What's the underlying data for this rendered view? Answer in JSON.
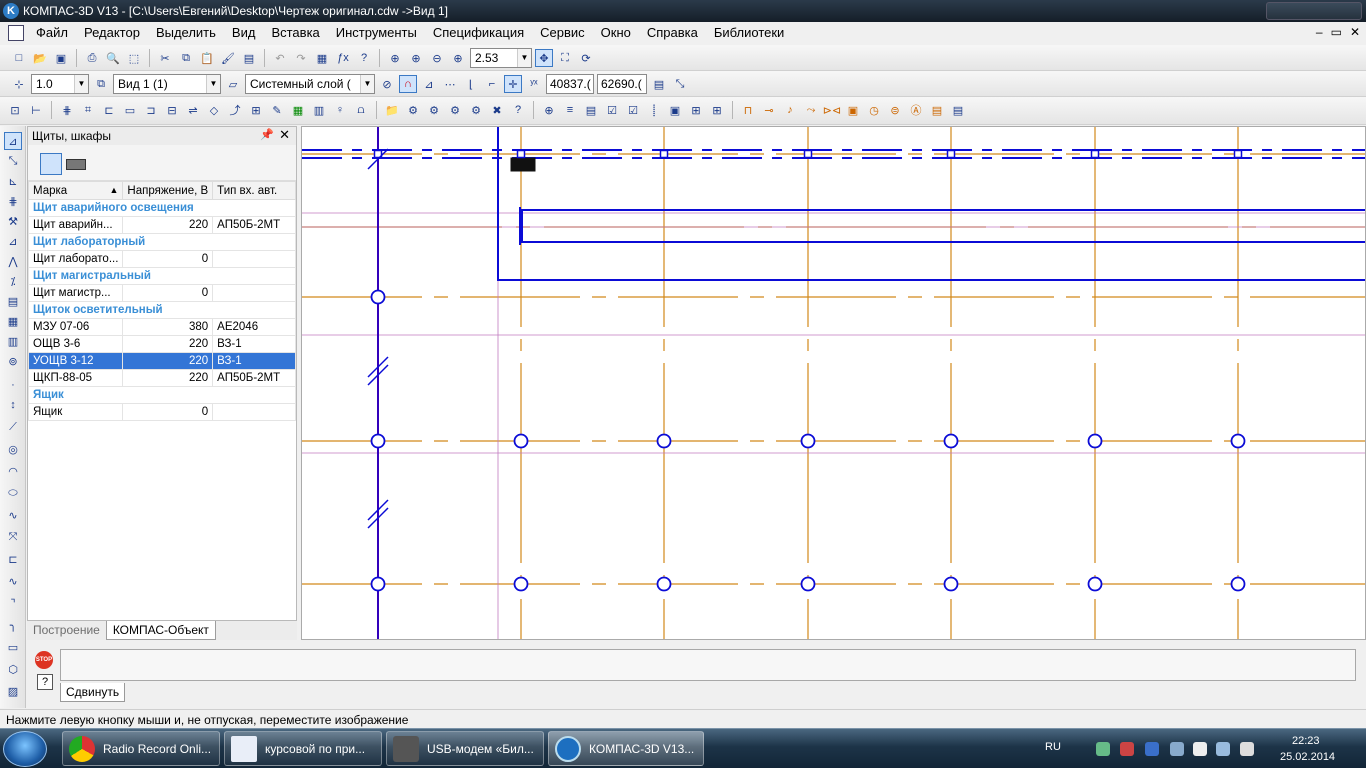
{
  "window": {
    "title": "КОМПАС-3D V13 - [C:\\Users\\Евгений\\Desktop\\Чертеж оригинал.cdw ->Вид 1]"
  },
  "menu": [
    "Файл",
    "Редактор",
    "Выделить",
    "Вид",
    "Вставка",
    "Инструменты",
    "Спецификация",
    "Сервис",
    "Окно",
    "Справка",
    "Библиотеки"
  ],
  "toolbar1": {
    "zoom_value": "2.53"
  },
  "toolbar2": {
    "step_value": "1.0",
    "view_value": "Вид 1 (1)",
    "layer_value": "Системный слой (",
    "coord_x": "40837.(",
    "coord_y": "62690.("
  },
  "panel": {
    "title": "Щиты, шкафы",
    "columns": [
      "Марка",
      "Напряжение, В",
      "Тип вх. авт."
    ],
    "rows": [
      {
        "group": "Щит аварийного освещения"
      },
      {
        "mark": "Щит аварийн...",
        "voltage": "220",
        "type": "АП50Б-2МТ"
      },
      {
        "group": "Щит лабораторный"
      },
      {
        "mark": "Щит лаборато...",
        "voltage": "0",
        "type": ""
      },
      {
        "group": "Щит магистральный"
      },
      {
        "mark": "Щит магистр...",
        "voltage": "0",
        "type": ""
      },
      {
        "group": "Щиток осветительный"
      },
      {
        "mark": "МЗУ 07-06",
        "voltage": "380",
        "type": "АЕ2046"
      },
      {
        "mark": "ОЩВ 3-6",
        "voltage": "220",
        "type": "ВЗ-1"
      },
      {
        "mark": "УОЩВ 3-12",
        "voltage": "220",
        "type": "ВЗ-1",
        "selected": true
      },
      {
        "mark": "ЩКП-88-05",
        "voltage": "220",
        "type": "АП50Б-2МТ"
      },
      {
        "group": "Ящик"
      },
      {
        "mark": "Ящик",
        "voltage": "0",
        "type": ""
      }
    ],
    "tabs": [
      "Построение",
      "КОМПАС-Объект"
    ]
  },
  "command": {
    "stop_label": "STOP",
    "help_label": "?",
    "tab_label": "Сдвинуть"
  },
  "status": {
    "message": "Нажмите левую кнопку мыши и, не отпуская, переместите изображение"
  },
  "taskbar": {
    "tasks": [
      {
        "label": "Radio Record Onli...",
        "icon": "chrome-icon"
      },
      {
        "label": "курсовой по при...",
        "icon": "word-icon"
      },
      {
        "label": "USB-модем «Бил...",
        "icon": "modem-icon"
      },
      {
        "label": "КОМПАС-3D V13...",
        "icon": "kompas-icon",
        "active": true
      }
    ],
    "lang": "RU",
    "time": "22:23",
    "date": "25.02.2014"
  },
  "colors": {
    "axis_orange": "#d2891a",
    "drawing_blue": "#0b0bd6",
    "group_text": "#3a8fd6",
    "selected_row": "#3375d6"
  }
}
